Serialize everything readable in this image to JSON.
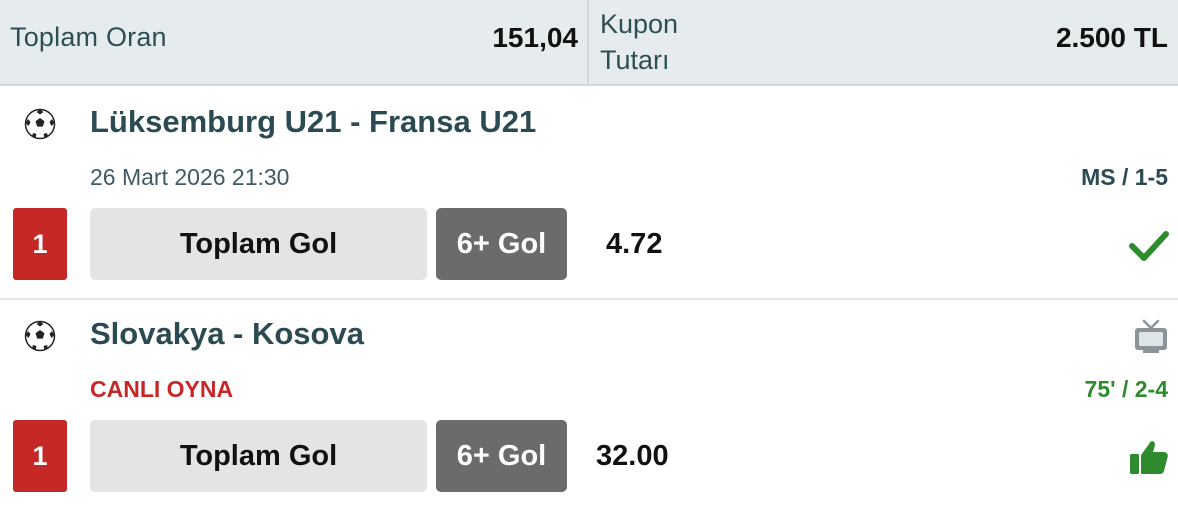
{
  "coupon": {
    "total_odds_label": "Toplam Oran",
    "total_odds_value": "151,04",
    "amount_label": "Kupon Tutarı",
    "amount_value": "2.500 TL"
  },
  "matches": [
    {
      "sport_icon": "soccer-ball-icon",
      "title": "Lüksemburg U21 - Fransa U21",
      "subline": "26 Mart 2026 21:30",
      "score": "MS / 1-5",
      "selection_number": "1",
      "market": "Toplam Gol",
      "pick": "6+ Gol",
      "odds": "4.72",
      "status_icon": "check-icon",
      "status_color": "#2e8b2e"
    },
    {
      "sport_icon": "soccer-ball-icon",
      "title": "Slovakya - Kosova",
      "subline": "CANLI OYNA",
      "score": "75' / 2-4",
      "selection_number": "1",
      "market": "Toplam Gol",
      "pick": "6+ Gol",
      "odds": "32.00",
      "media_icon": "tv-icon",
      "status_icon": "thumbs-up-icon",
      "status_color": "#2e8b2e"
    }
  ],
  "colors": {
    "badge_red": "#c62828",
    "title_teal": "#2c4a52",
    "live_red": "#c62828",
    "win_green": "#2e8b2e",
    "header_bg": "#e6ecee"
  }
}
